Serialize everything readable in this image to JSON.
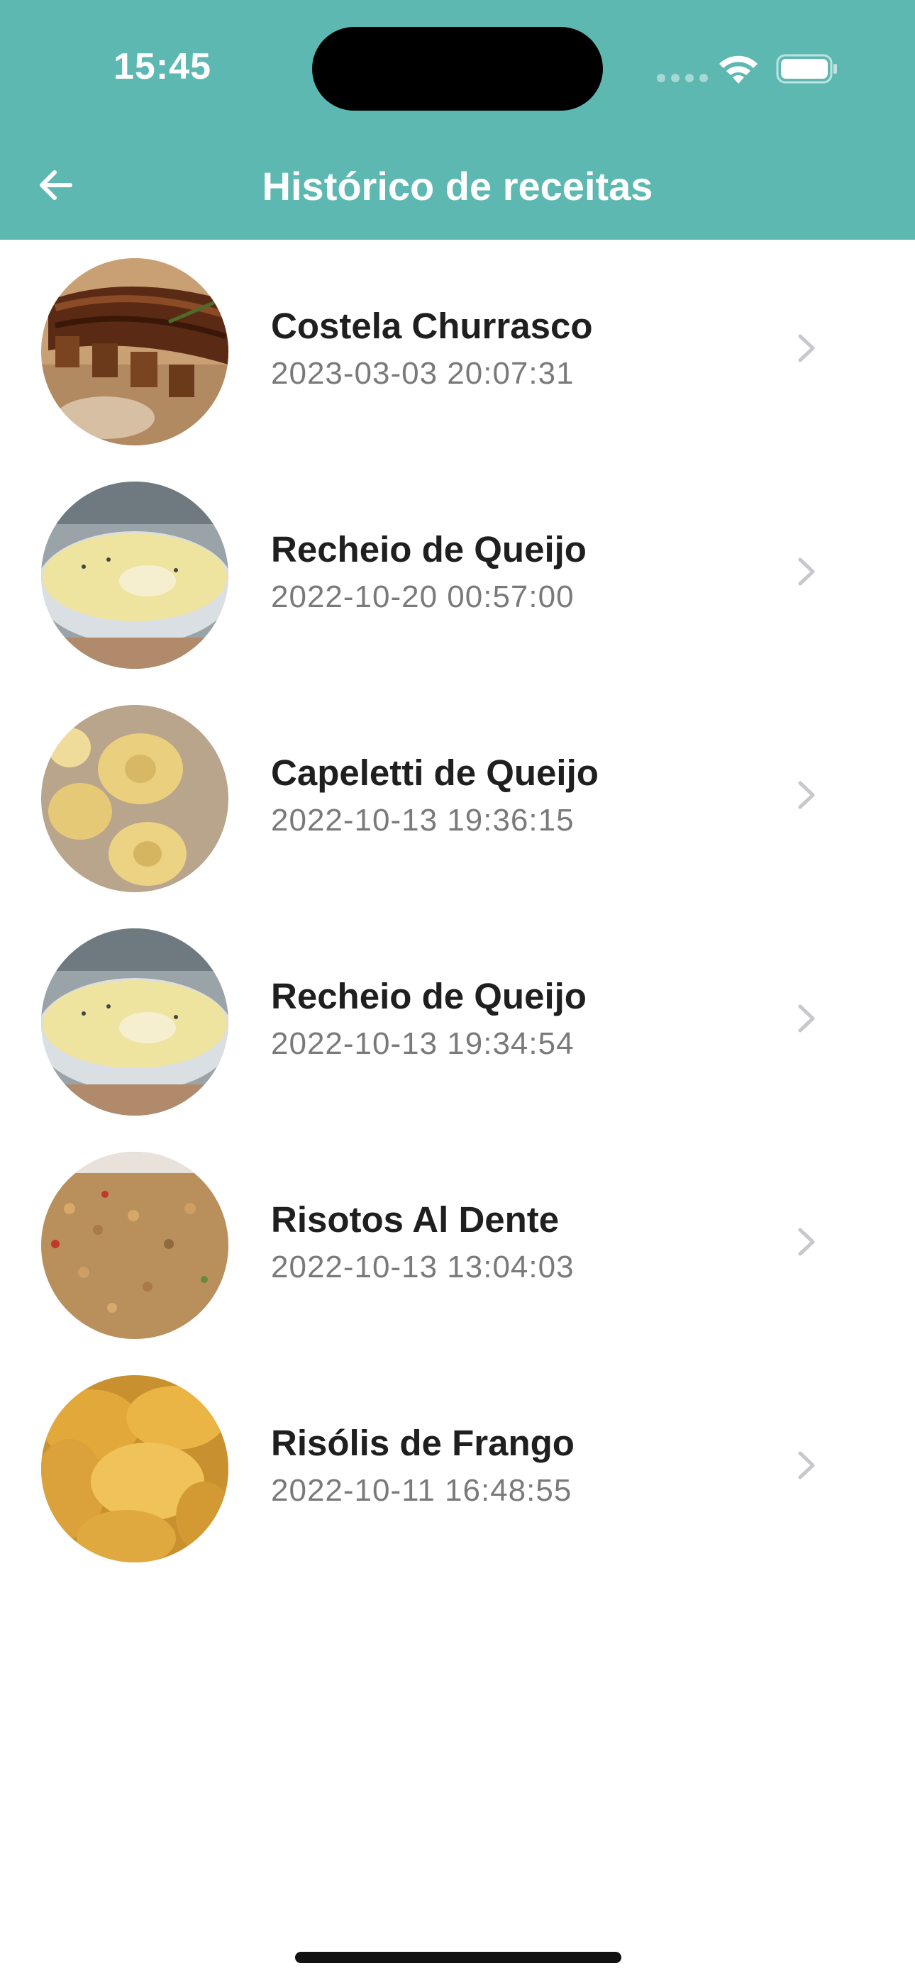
{
  "status_bar": {
    "time": "15:45"
  },
  "nav": {
    "title": "Histórico de receitas",
    "back_icon": "arrow-left-icon"
  },
  "colors": {
    "header": "#5DB8B1",
    "title_text": "#1f1f1f",
    "date_text": "#7a7a7a",
    "chevron": "#c7c7cc"
  },
  "recipes": [
    {
      "name": "Costela Churrasco",
      "date": "2023-03-03 20:07:31",
      "image": "ribs-photo"
    },
    {
      "name": "Recheio de Queijo",
      "date": "2022-10-20 00:57:00",
      "image": "cheese-sauce-photo"
    },
    {
      "name": "Capeletti de Queijo",
      "date": "2022-10-13 19:36:15",
      "image": "capeletti-photo"
    },
    {
      "name": "Recheio de Queijo",
      "date": "2022-10-13 19:34:54",
      "image": "cheese-sauce-photo"
    },
    {
      "name": "Risotos Al Dente",
      "date": "2022-10-13 13:04:03",
      "image": "risotto-photo"
    },
    {
      "name": "Risólis de Frango",
      "date": "2022-10-11 16:48:55",
      "image": "rissoles-photo"
    }
  ]
}
